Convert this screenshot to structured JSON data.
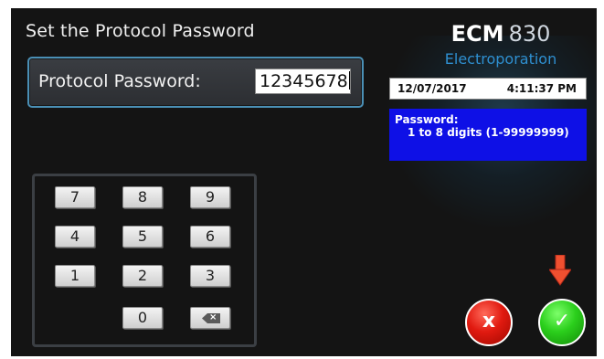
{
  "page": {
    "title": "Set the Protocol Password"
  },
  "password_field": {
    "label": "Protocol Password:",
    "value": "12345678"
  },
  "brand": {
    "name": "ECM",
    "model": "830",
    "subtitle": "Electroporation"
  },
  "status": {
    "date": "12/07/2017",
    "time": "4:11:37 PM"
  },
  "info": {
    "title": "Password:",
    "detail": "1 to 8 digits (1-99999999)"
  },
  "keypad": {
    "keys": [
      "7",
      "8",
      "9",
      "4",
      "5",
      "6",
      "1",
      "2",
      "3",
      "0"
    ],
    "backspace_icon": "backspace-icon"
  },
  "actions": {
    "cancel_icon": "x",
    "confirm_icon": "✓"
  },
  "colors": {
    "info_bg": "#0e10e6",
    "brand_sub": "#2e8fd0",
    "cancel": "#e11a10",
    "confirm": "#2bcf1c",
    "hint_arrow": "#f05030"
  }
}
